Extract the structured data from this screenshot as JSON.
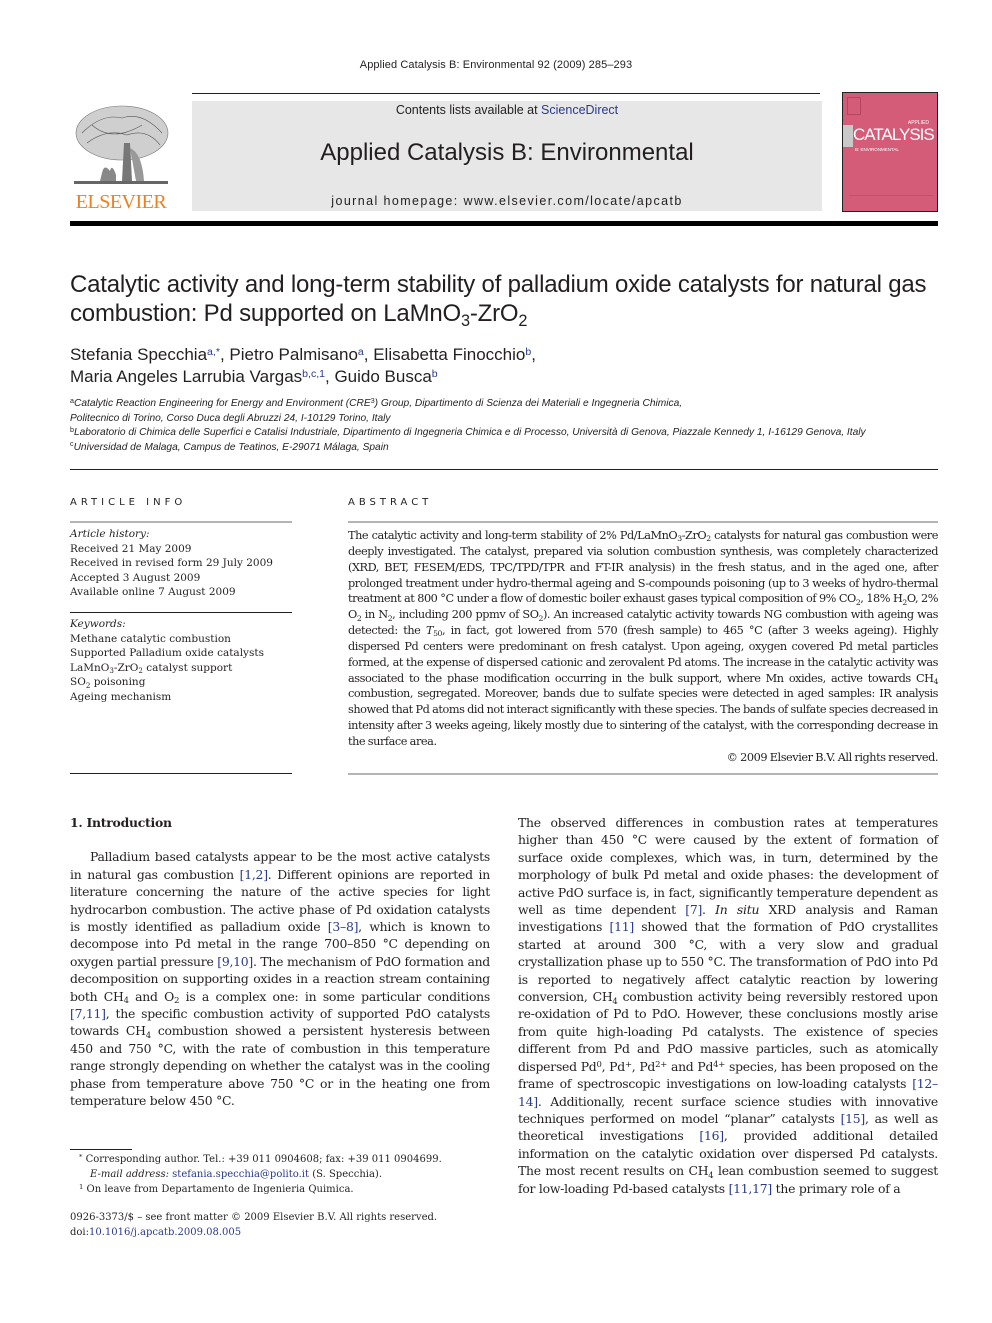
{
  "running_head": "Applied Catalysis B: Environmental 92 (2009) 285–293",
  "publisher": {
    "logo_icon": "elsevier-tree-logo",
    "name": "ELSEVIER",
    "brand_color": "#f07f1e"
  },
  "journal_banner": {
    "contents_prefix": "Contents lists available at ",
    "contents_link": "ScienceDirect",
    "journal_title": "Applied Catalysis B: Environmental",
    "homepage": "journal homepage: www.elsevier.com/locate/apcatb",
    "banner_color": "#e7e7e7"
  },
  "cover": {
    "icon": "journal-cover-thumbnail",
    "applied": "APPLIED",
    "title": "CATALYSIS",
    "subtitle": "B: ENVIRONMENTAL",
    "color": "#d45c78"
  },
  "article": {
    "title_part1": "Catalytic activity and long-term stability of palladium oxide catalysts for natural gas combustion: Pd supported on LaMnO",
    "title_sub1": "3",
    "title_part2": "-ZrO",
    "title_sub2": "2",
    "authors": [
      {
        "name": "Stefania Specchia",
        "aff": "a,*",
        "sep": ", "
      },
      {
        "name": "Pietro Palmisano",
        "aff": "a",
        "sep": ", "
      },
      {
        "name": "Elisabetta Finocchio",
        "aff": "b",
        "sep": ","
      },
      {
        "name": "Maria Angeles Larrubia Vargas",
        "aff": "b,c,1",
        "sep": ", "
      },
      {
        "name": "Guido Busca",
        "aff": "b",
        "sep": ""
      }
    ],
    "affiliations": {
      "a_mark": "a",
      "a_text1": "Catalytic Reaction Engineering for Energy and Environment (CRE",
      "a_sup": "3",
      "a_text2": ") Group, Dipartimento di Scienza dei Materiali e Ingegneria Chimica,",
      "a_line2": "Politecnico di Torino, Corso Duca degli Abruzzi 24, I-10129 Torino, Italy",
      "b_mark": "b",
      "b_text": "Laboratorio di Chimica delle Superfici e Catalisi Industriale, Dipartimento di Ingegneria Chimica e di Processo, Università di Genova, Piazzale Kennedy 1, I-16129 Genova, Italy",
      "c_mark": "c",
      "c_text": "Universidad de Malaga, Campus de Teatinos, E-29071 Málaga, Spain"
    }
  },
  "article_info": {
    "heading": "ARTICLE INFO",
    "history_label": "Article history:",
    "history": [
      "Received 21 May 2009",
      "Received in revised form 29 July 2009",
      "Accepted 3 August 2009",
      "Available online 7 August 2009"
    ],
    "keywords_label": "Keywords:",
    "keywords": {
      "k1": "Methane catalytic combustion",
      "k2": "Supported Palladium oxide catalysts",
      "k3a": "LaMnO",
      "k3s1": "3",
      "k3b": "-ZrO",
      "k3s2": "2",
      "k3c": " catalyst support",
      "k4a": "SO",
      "k4s": "2",
      "k4b": " poisoning",
      "k5": "Ageing mechanism"
    }
  },
  "abstract": {
    "heading": "ABSTRACT",
    "p1": "The catalytic activity and long-term stability of 2% Pd/LaMnO",
    "s1": "3",
    "p2": "-ZrO",
    "s2": "2",
    "p3": " catalysts for natural gas combustion were deeply investigated. The catalyst, prepared via solution combustion synthesis, was completely characterized (XRD, BET, FESEM/EDS, TPC/TPD/TPR and FT-IR analysis) in the fresh status, and in the aged one, after prolonged treatment under hydro-thermal ageing and S-compounds poisoning (up to 3 weeks of hydro-thermal treatment at 800 °C under a flow of domestic boiler exhaust gases typical composition of 9% CO",
    "s3": "2",
    "p4": ", 18% H",
    "s4": "2",
    "p5": "O, 2% O",
    "s5": "2",
    "p6": " in N",
    "s6": "2",
    "p7": ", including 200 ppmv of SO",
    "s7": "2",
    "p8": "). An increased catalytic activity towards NG combustion with ageing was detected: the ",
    "t50": "T",
    "t50s": "50",
    "p9": ", in fact, got lowered from 570 (fresh sample) to 465 °C (after 3 weeks ageing). Highly dispersed Pd centers were predominant on fresh catalyst. Upon ageing, oxygen covered Pd metal particles formed, at the expense of dispersed cationic and zerovalent Pd atoms. The increase in the catalytic activity was associated to the phase modification occurring in the bulk support, where Mn oxides, active towards CH",
    "s8": "4",
    "p10": " combustion, segregated. Moreover, bands due to sulfate species were detected in aged samples: IR analysis showed that Pd atoms did not interact significantly with these species. The bands of sulfate species decreased in intensity after 3 weeks ageing, likely mostly due to sintering of the catalyst, with the corresponding decrease in the surface area.",
    "copyright": "© 2009 Elsevier B.V. All rights reserved."
  },
  "intro": {
    "heading": "1.  Introduction",
    "l1": "Palladium based catalysts appear to be the most active catalysts in natural gas combustion ",
    "r1": "[1,2]",
    "l2": ". Different opinions are reported in literature concerning the nature of the active species for light hydrocarbon combustion. The active phase of Pd oxidation catalysts is mostly identified as palladium oxide ",
    "r2": "[3–8]",
    "l3": ", which is known to decompose into Pd metal in the range 700–850 °C depending on oxygen partial pressure ",
    "r3": "[9,10]",
    "l4": ". The mechanism of PdO formation and decomposition on supporting oxides in a reaction stream containing both CH",
    "s1": "4",
    "l5": " and O",
    "s2": "2",
    "l6": " is a complex one: in some particular conditions ",
    "r4": "[7,11]",
    "l7": ", the specific combustion activity of supported PdO catalysts towards CH",
    "s3": "4",
    "l8": " combustion showed a persistent hysteresis between 450 and 750 °C, with the rate of combustion in this temperature range strongly depending on whether the catalyst was in the cooling phase from temperature above 750 °C or in the heating one from temperature below 450 °C."
  },
  "right_col": {
    "a1": "The observed differences in combustion rates at temperatures higher than 450 °C were caused by the extent of formation of surface oxide complexes, which was, in turn, determined by the morphology of bulk Pd metal and oxide phases: the development of active PdO surface is, in fact, significantly temperature dependent as well as time dependent ",
    "r1": "[7]",
    "a2": ". ",
    "insitu": "In situ",
    "a3": " XRD analysis and Raman investigations ",
    "r2": "[11]",
    "a4": " showed that the formation of PdO crystallites started at around 300 °C, with a very slow and gradual crystallization phase up to 550 °C. The transformation of PdO into Pd is reported to negatively affect catalytic reaction by lowering conversion, CH",
    "s1": "4",
    "a5": " combustion activity being reversibly restored upon re-oxidation of Pd to PdO. However, these conclusions mostly arise from quite high-loading Pd catalysts. The existence of species different from Pd and PdO massive particles, such as atomically dispersed Pd",
    "p0": "0",
    "a6": ", Pd",
    "p1": "+",
    "a7": ", Pd",
    "p2": "2+",
    "a8": " and Pd",
    "p4": "4+",
    "a9": " species, has been proposed on the frame of spectroscopic investigations on low-loading catalysts ",
    "r3": "[12–14]",
    "a10": ". Additionally, recent surface science studies with innovative techniques performed on model “planar” catalysts ",
    "r4": "[15]",
    "a11": ", as well as theoretical investigations ",
    "r5": "[16]",
    "a12": ", provided additional detailed information on the catalytic oxidation over dispersed Pd catalysts. The most recent results on CH",
    "s2": "4",
    "a13": " lean combustion seemed to suggest for low-loading Pd-based catalysts ",
    "r6": "[11,17]",
    "a14": " the primary role of a"
  },
  "footnotes": {
    "star_mark": "*",
    "star_text": "Corresponding author. Tel.: +39 011 0904608; fax: +39 011 0904699.",
    "email_label": "E-mail address:",
    "email": "stefania.specchia@polito.it",
    "email_suffix": " (S. Specchia).",
    "one_mark": "1",
    "one_text": "On leave from Departamento de Ingenieria Quimica."
  },
  "issn": {
    "line1": "0926-3373/$ – see front matter © 2009 Elsevier B.V. All rights reserved.",
    "doi_prefix": "doi:",
    "doi": "10.1016/j.apcatb.2009.08.005"
  },
  "colors": {
    "link": "#2a3a8c",
    "text": "#231f20"
  }
}
